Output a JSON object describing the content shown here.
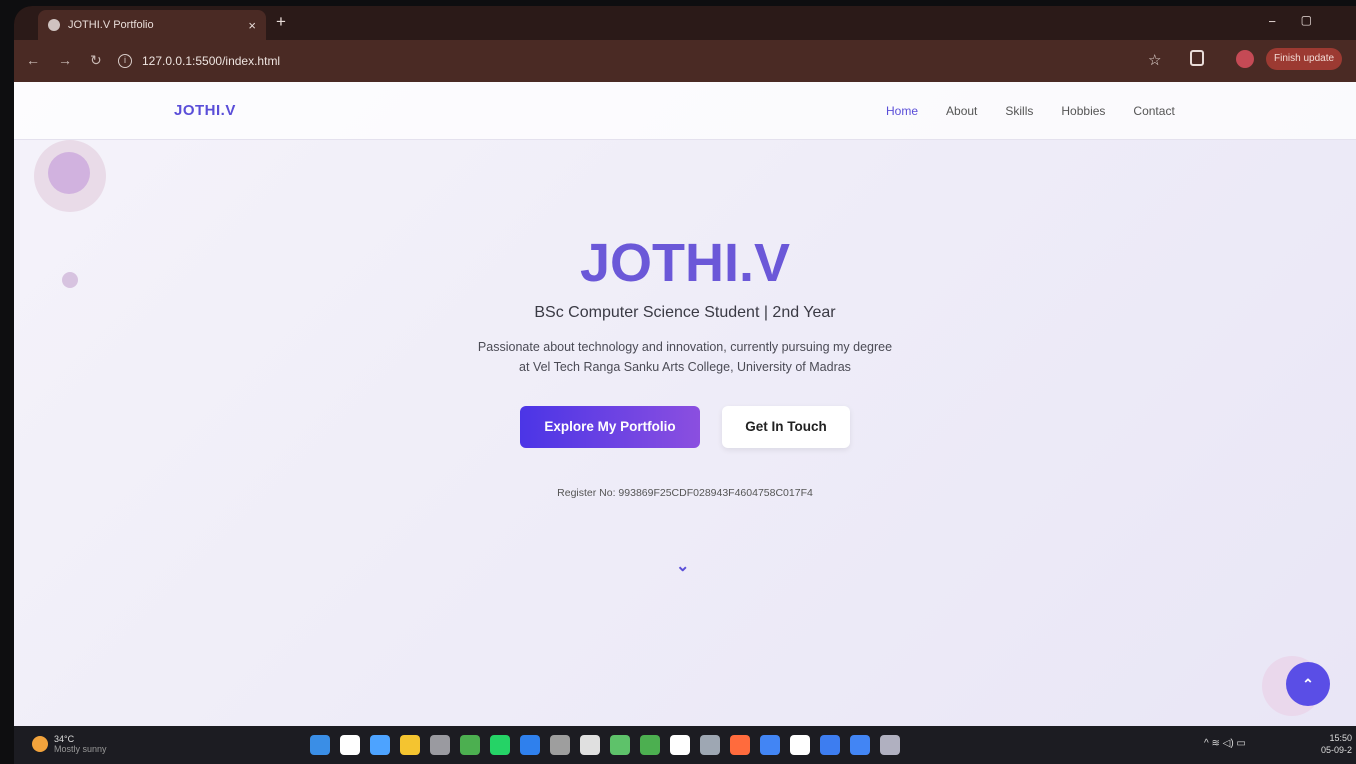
{
  "browser": {
    "tab_title": "JOTHI.V Portfolio",
    "tab_close": "×",
    "new_tab": "+",
    "url": "127.0.0.1:5500/index.html",
    "update_button": "Finish update",
    "minimize": "−",
    "maximize": "▢",
    "back": "←",
    "forward": "→",
    "reload": "↻",
    "star": "☆",
    "info": "i"
  },
  "site": {
    "brand": "JOTHI.V",
    "nav": [
      {
        "label": "Home"
      },
      {
        "label": "About"
      },
      {
        "label": "Skills"
      },
      {
        "label": "Hobbies"
      },
      {
        "label": "Contact"
      }
    ]
  },
  "hero": {
    "name": "JOTHI.V",
    "subtitle": "BSc Computer Science Student | 2nd Year",
    "description_line1": "Passionate about technology and innovation, currently pursuing my degree",
    "description_line2": "at Vel Tech Ranga Sanku Arts College, University of Madras",
    "primary_button": "Explore My Portfolio",
    "secondary_button": "Get In Touch",
    "register": "Register No: 993869F25CDF028943F4604758C017F4",
    "scroll_icon": "⌄",
    "back_to_top_icon": "⌃"
  },
  "taskbar": {
    "temperature": "34°C",
    "condition": "Mostly sunny",
    "time": "15:50",
    "date": "05-09-2",
    "tray": "^  ≋  ◁)  ▭",
    "apps": [
      "#3a8ee6",
      "#ffffff",
      "#4da3ff",
      "#f4c430",
      "#9a9aa0",
      "#4caf50",
      "#25d366",
      "#2f80ed",
      "#9e9e9e",
      "#e0e0e0",
      "#5ec26a",
      "#4caf50",
      "#ffffff",
      "#9ea7b3",
      "#ff6b3d",
      "#4285f4",
      "#ffffff",
      "#3d7df0",
      "#4285f4",
      "#b0b0c0"
    ]
  }
}
